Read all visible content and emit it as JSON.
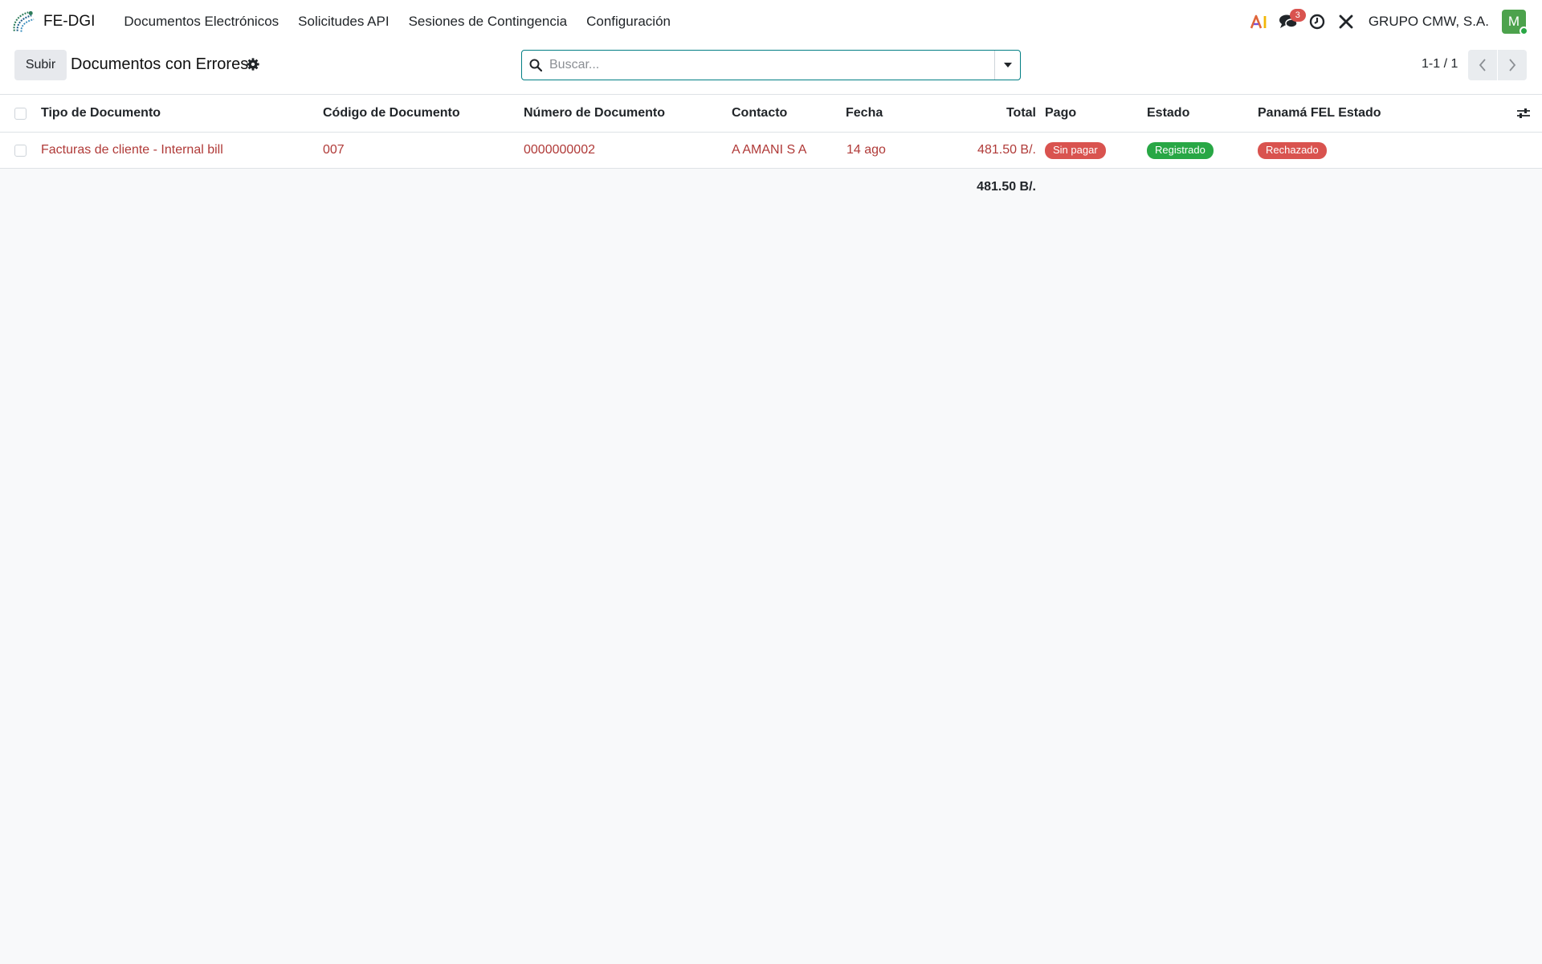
{
  "navbar": {
    "app_name": "FE-DGI",
    "menu": [
      {
        "label": "Documentos Electrónicos"
      },
      {
        "label": "Solicitudes API"
      },
      {
        "label": "Sesiones de Contingencia"
      },
      {
        "label": "Configuración"
      }
    ],
    "messages_count": "3",
    "company": "GRUPO CMW, S.A.",
    "avatar_initial": "M"
  },
  "control_panel": {
    "upload_label": "Subir",
    "title": "Documentos con Errores",
    "search_placeholder": "Buscar...",
    "pager": "1-1 / 1"
  },
  "table": {
    "columns": [
      {
        "label": "Tipo de Documento"
      },
      {
        "label": "Código de Documento"
      },
      {
        "label": "Número de Documento"
      },
      {
        "label": "Contacto"
      },
      {
        "label": "Fecha"
      },
      {
        "label": "Total"
      },
      {
        "label": "Pago"
      },
      {
        "label": "Estado"
      },
      {
        "label": "Panamá FEL Estado"
      }
    ],
    "rows": [
      {
        "tipo": "Facturas de cliente - Internal bill",
        "codigo": "007",
        "numero": "0000000002",
        "contacto": "A AMANI S A",
        "fecha": "14 ago",
        "total": "481.50 B/.",
        "pago": "Sin pagar",
        "estado": "Registrado",
        "fel_estado": "Rechazado"
      }
    ],
    "footer_total": "481.50 B/."
  },
  "colors": {
    "accent": "#017e84",
    "danger": "#d9534f",
    "success": "#28a745",
    "row_text": "#b03a38"
  },
  "icons": [
    "app-logo-icon",
    "ai-icon",
    "chat-icon",
    "clock-icon",
    "tools-icon",
    "gear-icon",
    "search-icon",
    "caret-down-icon",
    "chevron-left-icon",
    "chevron-right-icon",
    "sliders-icon"
  ]
}
